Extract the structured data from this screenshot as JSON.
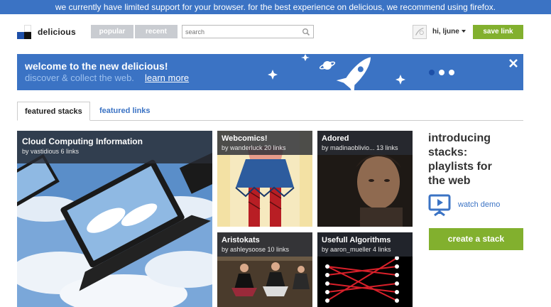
{
  "browser_warning": "we currently have limited support for your browser. for the best experience on delicious, we recommend using firefox.",
  "header": {
    "logo_text": "delicious",
    "nav": [
      {
        "label": "popular"
      },
      {
        "label": "recent"
      }
    ],
    "search": {
      "placeholder": "search",
      "value": ""
    },
    "user_label": "hi, ljune",
    "save_label": "save link"
  },
  "banner": {
    "title": "welcome to the new delicious!",
    "subtitle": "discover & collect the web.",
    "link": "learn more",
    "slides": 3,
    "active_slide": 0
  },
  "tabs": [
    {
      "label": "featured stacks",
      "active": true
    },
    {
      "label": "featured links",
      "active": false
    }
  ],
  "stacks": [
    {
      "title": "Cloud Computing Information",
      "meta": "by vastidious 6 links"
    },
    {
      "title": "Webcomics!",
      "meta": "by wanderluck 20 links"
    },
    {
      "title": "Adored",
      "meta": "by madinaoblivio... 13 links"
    },
    {
      "title": "Aristokats",
      "meta": "by ashleysoose 10 links"
    },
    {
      "title": "Usefull Algorithms",
      "meta": "by aaron_mueller 4 links"
    }
  ],
  "promo": {
    "lines": [
      "introducing",
      "stacks:",
      "playlists for",
      "the web"
    ],
    "demo_label": "watch demo",
    "create_label": "create a stack"
  },
  "colors": {
    "brand_blue": "#3b73c4",
    "accent_green": "#82b02e",
    "nav_gray": "#c9ccd1"
  }
}
